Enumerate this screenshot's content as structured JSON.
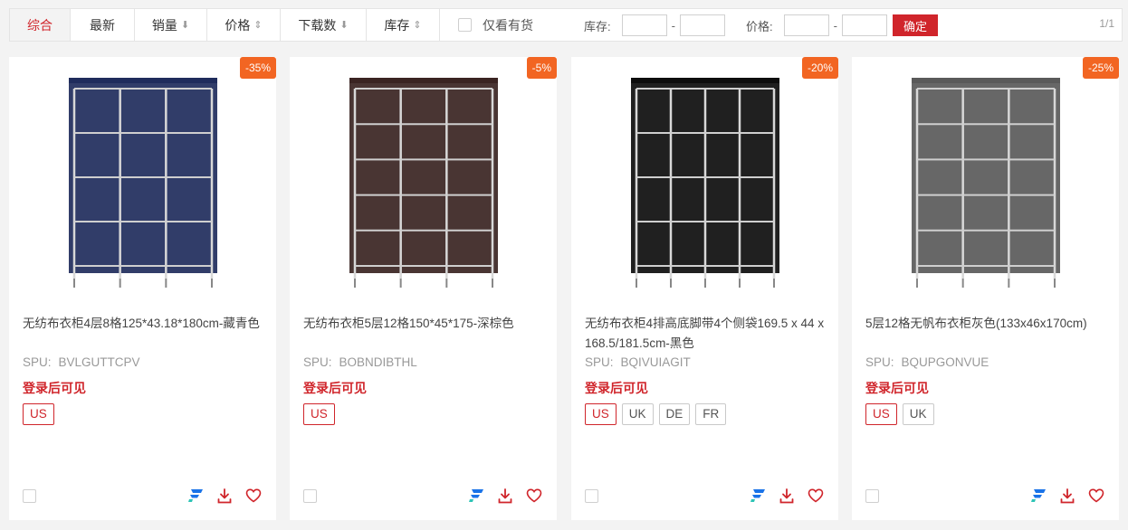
{
  "filter_bar": {
    "sort_tabs": [
      {
        "label": "综合",
        "arrow": ""
      },
      {
        "label": "最新",
        "arrow": ""
      },
      {
        "label": "销量",
        "arrow": "⬇"
      },
      {
        "label": "价格",
        "arrow": "⇕"
      },
      {
        "label": "下载数",
        "arrow": "⬇"
      },
      {
        "label": "库存",
        "arrow": "⇕"
      }
    ],
    "in_stock_label": "仅看有货",
    "stock_range_label": "库存:",
    "price_range_label": "价格:",
    "range_dash": "-",
    "stock_min": "",
    "stock_max": "",
    "price_min": "",
    "price_max": "",
    "confirm_label": "确定",
    "pagination": "1/1"
  },
  "products": [
    {
      "title": "无纺布衣柜4层8格125*43.18*180cm-藏青色",
      "spu_label": "SPU:",
      "spu": "BVLGUTTCPV",
      "price_note": "登录后可见",
      "discount": "-35%",
      "regions": [
        "US"
      ],
      "color": "#1f2c5c",
      "icons": [
        "brand-f-icon",
        "download-icon",
        "heart-icon"
      ]
    },
    {
      "title": "无纺布衣柜5层12格150*45*175-深棕色",
      "spu_label": "SPU:",
      "spu": "BOBNDIBTHL",
      "price_note": "登录后可见",
      "discount": "-5%",
      "regions": [
        "US"
      ],
      "color": "#3a2422",
      "icons": [
        "brand-f-icon",
        "download-icon",
        "heart-icon"
      ]
    },
    {
      "title": "无纺布衣柜4排高底脚带4个侧袋169.5 x 44 x 168.5/181.5cm-黑色",
      "spu_label": "SPU:",
      "spu": "BQIVUIAGIT",
      "price_note": "登录后可见",
      "discount": "-20%",
      "regions": [
        "US",
        "UK",
        "DE",
        "FR"
      ],
      "color": "#0d0d0d",
      "icons": [
        "brand-f-icon",
        "download-icon",
        "heart-icon"
      ]
    },
    {
      "title": "5层12格无帆布衣柜灰色(133x46x170cm)",
      "spu_label": "SPU:",
      "spu": "BQUPGONVUE",
      "price_note": "登录后可见",
      "discount": "-25%",
      "regions": [
        "US",
        "UK"
      ],
      "color": "#5a5a5a",
      "icons": [
        "brand-f-icon",
        "download-icon",
        "heart-icon"
      ]
    }
  ],
  "colors": {
    "accent_red": "#d0252b",
    "badge_orange": "#f26522",
    "brand_blue": "#1a73e8"
  }
}
